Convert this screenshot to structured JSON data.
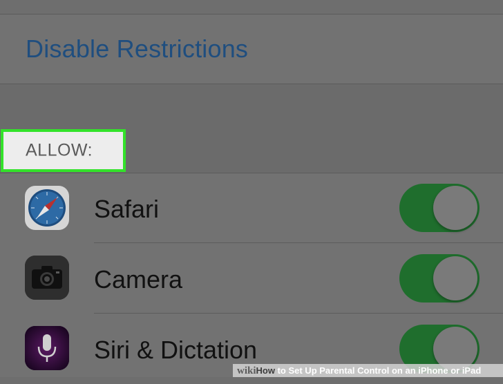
{
  "restrictions": {
    "disable_label": "Disable Restrictions",
    "allow_header": "ALLOW:",
    "items": [
      {
        "label": "Safari",
        "icon": "safari-icon",
        "enabled": true
      },
      {
        "label": "Camera",
        "icon": "camera-icon",
        "enabled": true
      },
      {
        "label": "Siri & Dictation",
        "icon": "siri-icon",
        "enabled": true
      }
    ]
  },
  "colors": {
    "link_blue": "#1f4e7f",
    "highlight_green": "#33e22a",
    "toggle_green": "#1f6e2d"
  },
  "watermark": {
    "wiki": "wiki",
    "how": "How",
    "rest": " to Set Up Parental Control on an iPhone or iPad"
  }
}
